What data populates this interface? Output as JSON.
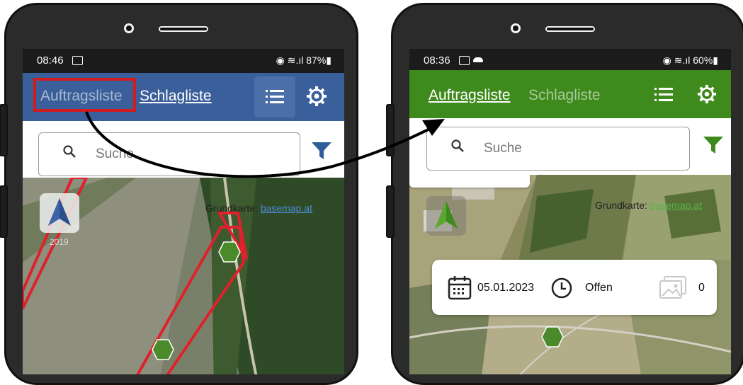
{
  "left_phone": {
    "status": {
      "time": "08:46",
      "indicators": "◉ ≋.ıl 87%▮",
      "notification_icon": "image-icon"
    },
    "appbar": {
      "tab_active": "Schlagliste",
      "tab_inactive": "Auftragsliste",
      "color": "#3a5f9a"
    },
    "search": {
      "placeholder": "Suche"
    },
    "map": {
      "credit_label": "Grundkarte:",
      "credit_link": "basemap.at",
      "logo_year": "2019"
    }
  },
  "right_phone": {
    "status": {
      "time": "08:36",
      "indicators": "◉ ≋.ıl 60%▮",
      "notification_icon": "image-icon"
    },
    "appbar": {
      "tab_active": "Auftragsliste",
      "tab_inactive": "Schlagliste",
      "color": "#3f8a1d"
    },
    "search": {
      "placeholder": "Suche"
    },
    "map": {
      "credit_label": "Grundkarte:",
      "credit_link": "basemap.at"
    },
    "card": {
      "date": "05.01.2023",
      "status": "Offen",
      "photo_count": "0"
    }
  },
  "annotation": {
    "highlight_color": "#d01c1c",
    "arrow_color": "#000000"
  }
}
